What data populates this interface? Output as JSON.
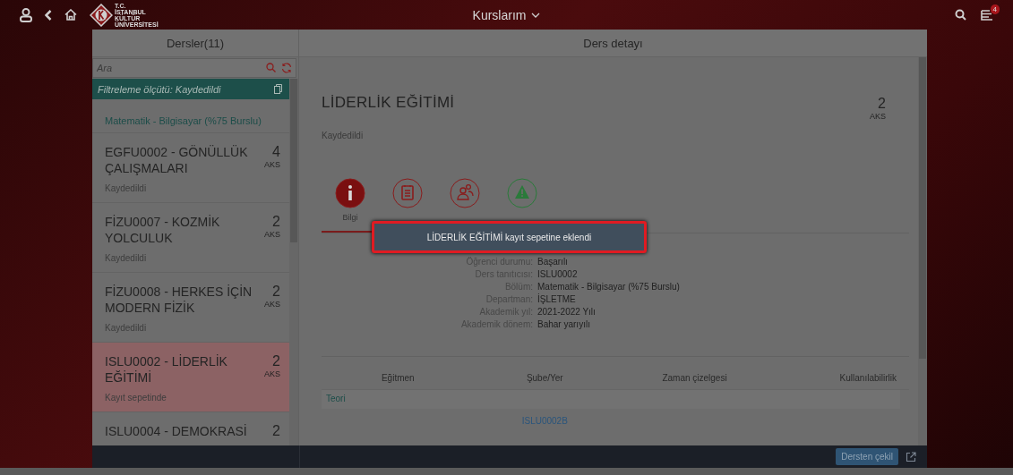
{
  "top_bar": {
    "logo_text": [
      "T.C.",
      "İSTANBUL",
      "KÜLTÜR",
      "ÜNİVERSİTESİ"
    ],
    "title": "Kurslarım",
    "notification_count": "4"
  },
  "course_list": {
    "title": "Dersler(11)",
    "search": {
      "placeholder": "Ara"
    },
    "filter": "Filtreleme ölçütü: Kaydedildi",
    "group": "Matematik - Bilgisayar (%75 Burslu)",
    "items": [
      {
        "title": "EGFU0002 - GÖNÜLLÜK ÇALIŞMALARI",
        "credits": "4",
        "unit": "AKS",
        "status": "Kaydedildi",
        "selected": false
      },
      {
        "title": "FİZU0007 - KOZMİK YOLCULUK",
        "credits": "2",
        "unit": "AKS",
        "status": "Kaydedildi",
        "selected": false
      },
      {
        "title": "FİZU0008 - HERKES İÇİN MODERN FİZİK",
        "credits": "2",
        "unit": "AKS",
        "status": "Kaydedildi",
        "selected": false
      },
      {
        "title": "ISLU0002 - LİDERLİK EĞİTİMİ",
        "credits": "2",
        "unit": "AKS",
        "status": "Kayıt sepetinde",
        "selected": true
      },
      {
        "title": "ISLU0004 - DEMOKRASİ",
        "credits": "2",
        "selected": false
      }
    ]
  },
  "detail": {
    "header": "Ders detayı",
    "title": "LİDERLİK EĞİTİMİ",
    "credits": "2",
    "unit": "AKS",
    "status": "Kaydedildi",
    "tabs": [
      {
        "kind": "info",
        "label": "Bilgi",
        "selected": true
      },
      {
        "kind": "list",
        "selected": false
      },
      {
        "kind": "people",
        "selected": false
      },
      {
        "kind": "warning",
        "selected": false
      }
    ],
    "fields": [
      {
        "label": "Öğrenci durumu:",
        "value": "Başarılı"
      },
      {
        "label": "Ders tanıtıcısı:",
        "value": "ISLU0002"
      },
      {
        "label": "Bölüm:",
        "value": "Matematik - Bilgisayar (%75 Burslu)"
      },
      {
        "label": "Departman:",
        "value": "İŞLETME"
      },
      {
        "label": "Akademik yıl:",
        "value": "2021-2022 Yılı"
      },
      {
        "label": "Akademik dönem:",
        "value": "Bahar yarıyılı"
      }
    ],
    "table": {
      "columns": [
        "Eğitmen",
        "Şube/Yer",
        "Zaman çizelgesi",
        "Kullanılabilirlik"
      ],
      "group": "Teori",
      "rows": [
        {
          "section": "ISLU0002B"
        }
      ]
    }
  },
  "footer": {
    "button": "Dersten çekil"
  },
  "toast": {
    "message": "LİDERLİK EĞİTİMİ kayıt sepetine eklendi"
  }
}
